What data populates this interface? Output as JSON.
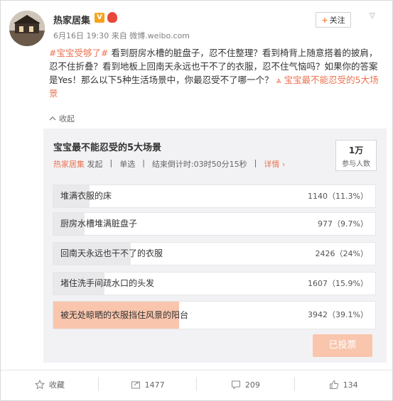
{
  "author": {
    "name": "热家居集",
    "meta": "6月16日 19:30 来自 微博.weibo.com",
    "follow_label": "关注"
  },
  "post": {
    "topic": "#宝宝受够了#",
    "body": " 看到厨房水槽的脏盘子，忍不住整理？看到椅背上随意搭着的披肩，忍不住折叠？看到地板上回南天永远也干不了的衣服，忍不住气恼吗？如果你的答案是Yes！那么以下5种生活场景中，你最忍受不了哪一个？ ",
    "poll_link": "宝宝最不能忍受的5大场景"
  },
  "collapse_label": "收起",
  "poll": {
    "title": "宝宝最不能忍受的5大场景",
    "author": "热家居集",
    "published": "发起",
    "mode": "单选",
    "countdown": "结束倒计时:03时50分15秒",
    "detail_label": "详情",
    "participants": "1万",
    "participants_label": "参与人数",
    "options": [
      {
        "label": "堆满衣服的床",
        "stat": "1140（11.3%）",
        "fraction": 0.113,
        "chosen": false
      },
      {
        "label": "厨房水槽堆满脏盘子",
        "stat": "977（9.7%）",
        "fraction": 0.097,
        "chosen": false
      },
      {
        "label": "回南天永远也干不了的衣服",
        "stat": "2426（24%）",
        "fraction": 0.24,
        "chosen": false
      },
      {
        "label": "堵住洗手间疏水口的头发",
        "stat": "1607（15.9%）",
        "fraction": 0.159,
        "chosen": false
      },
      {
        "label": "被无处晾晒的衣服挡住风景的阳台",
        "stat": "3942（39.1%）",
        "fraction": 0.391,
        "chosen": true
      }
    ],
    "voted_label": "已投票"
  },
  "actions": {
    "favorite": "收藏",
    "repost": "1477",
    "comment": "209",
    "like": "134"
  },
  "colors": {
    "accent": "#eb7350",
    "chosen_fill": "#f9c5ad",
    "panel_bg": "#f2f2f5"
  }
}
